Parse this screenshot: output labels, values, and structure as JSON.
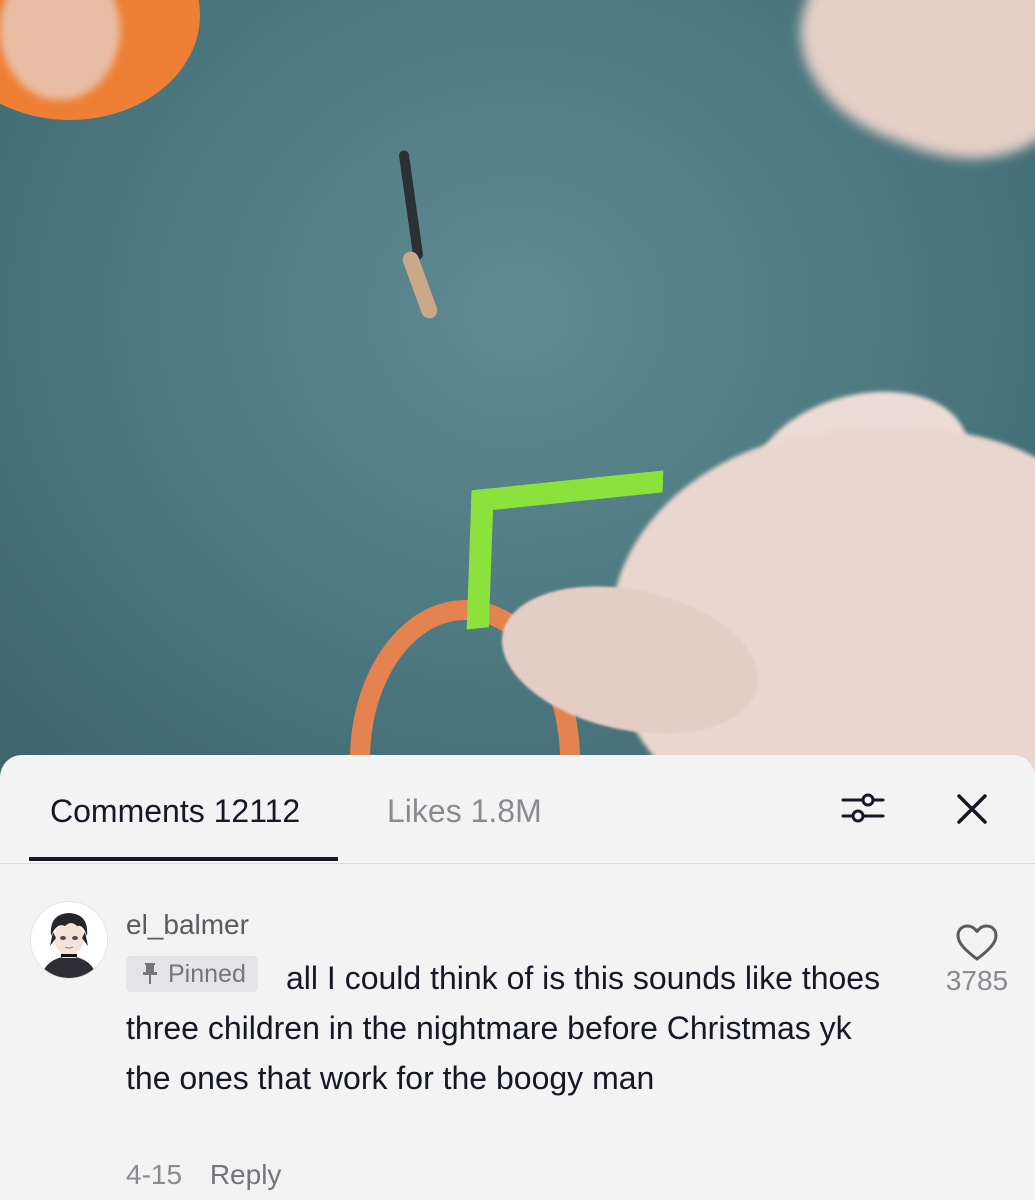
{
  "video": {
    "description_icon": "video-frame"
  },
  "comments_panel": {
    "tabs": [
      {
        "label": "Comments 12112",
        "active": true
      },
      {
        "label": "Likes 1.8M",
        "active": false
      }
    ],
    "filter_icon": "filter-sliders-icon",
    "close_icon": "close-icon"
  },
  "comment": {
    "username": "el_balmer",
    "pinned_label": "Pinned",
    "text": "all I could think of is this sounds like thoes three children in the nightmare before Christmas yk the ones that work for the boogy man",
    "date": "4-15",
    "reply_label": "Reply",
    "like_count": "3785",
    "heart_icon": "heart-outline-icon",
    "avatar_icon": "anime-avatar"
  },
  "colors": {
    "text_primary": "#161823",
    "text_secondary": "#8a8b91",
    "sheet_bg": "#f3f3f3",
    "pinned_bg": "#e4e4e6"
  }
}
